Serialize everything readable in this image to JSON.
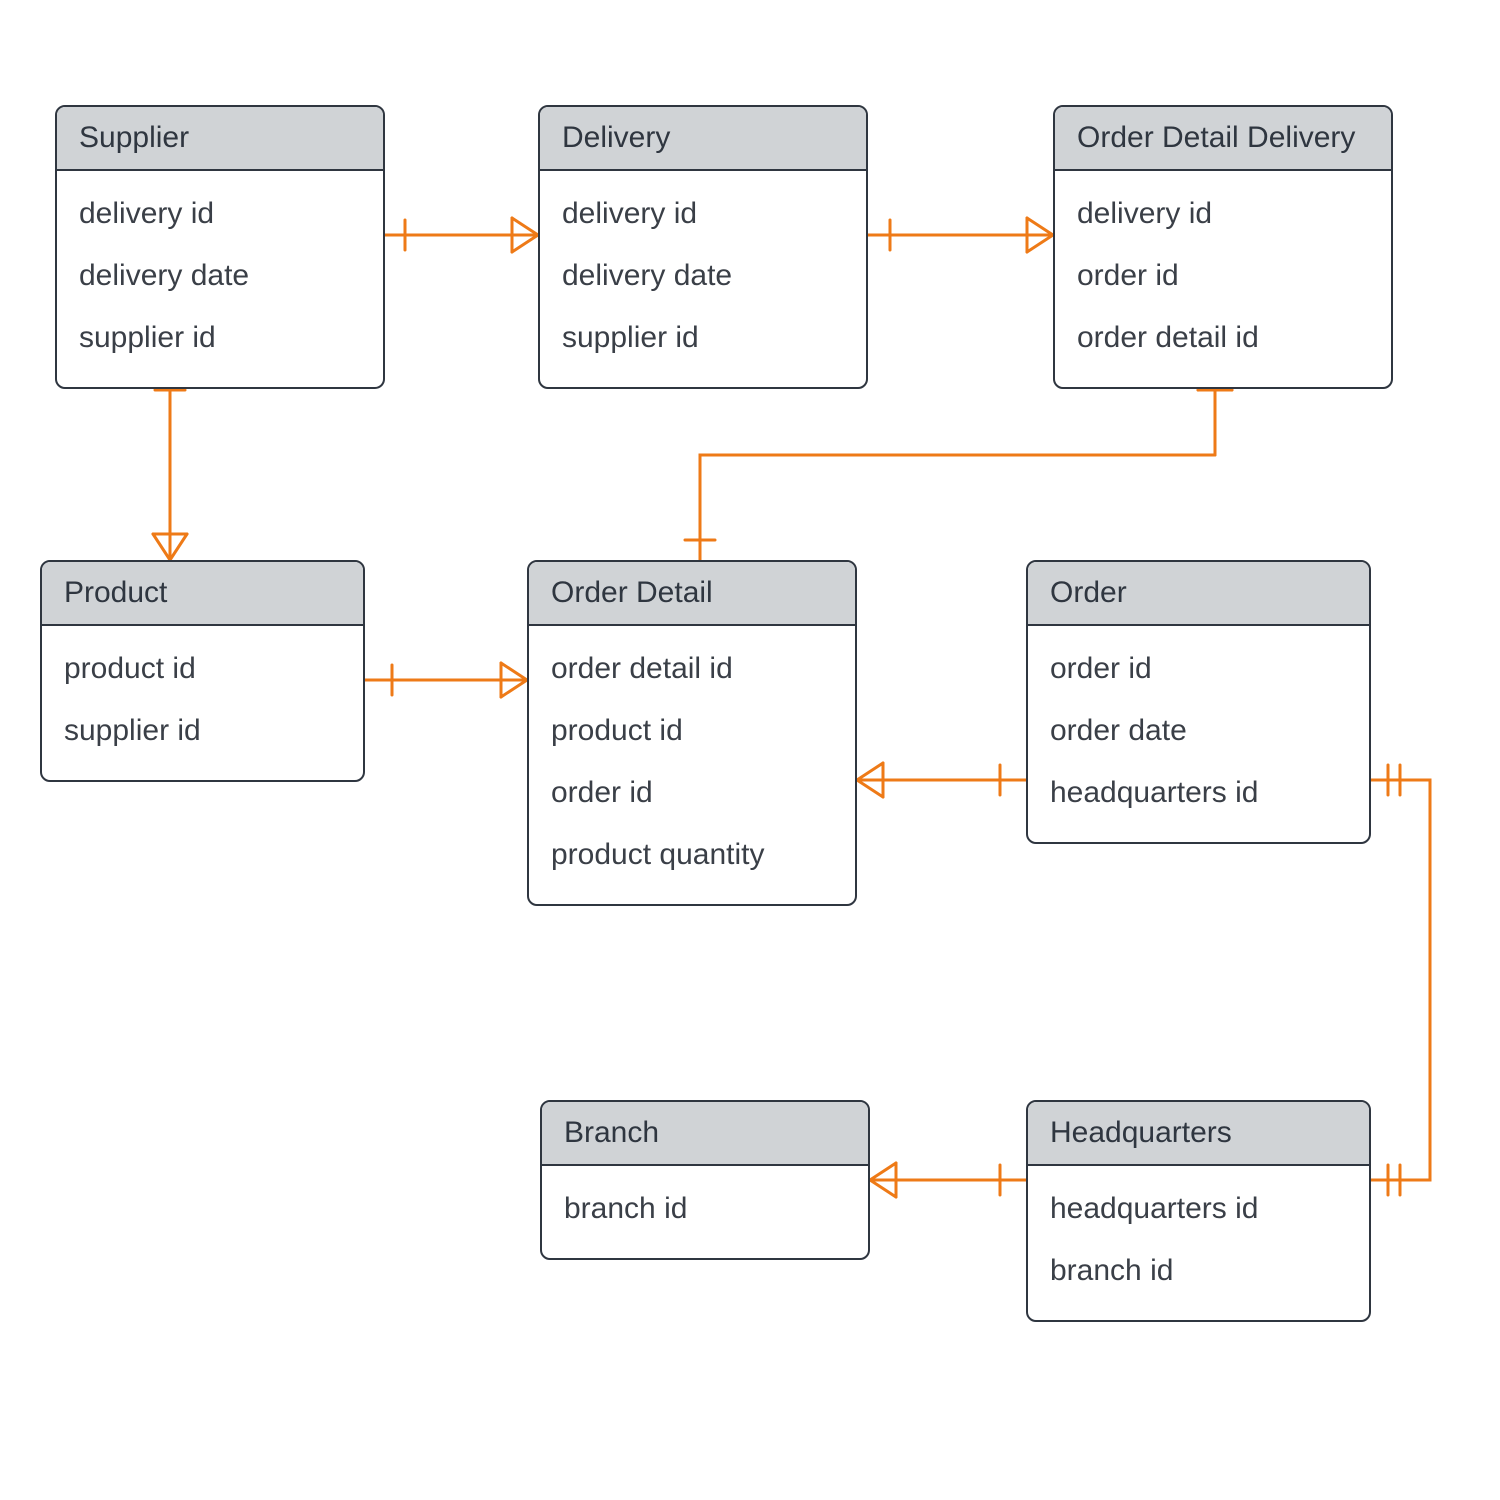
{
  "diagram_type": "entity-relationship",
  "colors": {
    "connector": "#ee7a17",
    "header_fill": "#d0d3d6",
    "border": "#2f3640"
  },
  "entities": {
    "supplier": {
      "title": "Supplier",
      "attrs": [
        "delivery id",
        "delivery date",
        "supplier id"
      ]
    },
    "delivery": {
      "title": "Delivery",
      "attrs": [
        "delivery id",
        "delivery date",
        "supplier id"
      ]
    },
    "order_detail_delivery": {
      "title": "Order Detail Delivery",
      "attrs": [
        "delivery id",
        "order id",
        "order detail id"
      ]
    },
    "product": {
      "title": "Product",
      "attrs": [
        "product id",
        "supplier id"
      ]
    },
    "order_detail": {
      "title": "Order Detail",
      "attrs": [
        "order detail id",
        "product id",
        "order id",
        "product quantity"
      ]
    },
    "order": {
      "title": "Order",
      "attrs": [
        "order id",
        "order date",
        "headquarters id"
      ]
    },
    "branch": {
      "title": "Branch",
      "attrs": [
        "branch id"
      ]
    },
    "headquarters": {
      "title": "Headquarters",
      "attrs": [
        "headquarters id",
        "branch id"
      ]
    }
  },
  "relationships": [
    {
      "from": "supplier",
      "to": "delivery",
      "type": "one-to-many"
    },
    {
      "from": "delivery",
      "to": "order_detail_delivery",
      "type": "one-to-many"
    },
    {
      "from": "supplier",
      "to": "product",
      "type": "one-to-many"
    },
    {
      "from": "product",
      "to": "order_detail",
      "type": "one-to-many"
    },
    {
      "from": "order",
      "to": "order_detail",
      "type": "one-to-many"
    },
    {
      "from": "order_detail",
      "to": "order_detail_delivery",
      "type": "one-to-many"
    },
    {
      "from": "headquarters",
      "to": "order",
      "type": "one-to-one"
    },
    {
      "from": "headquarters",
      "to": "branch",
      "type": "one-to-many"
    }
  ]
}
